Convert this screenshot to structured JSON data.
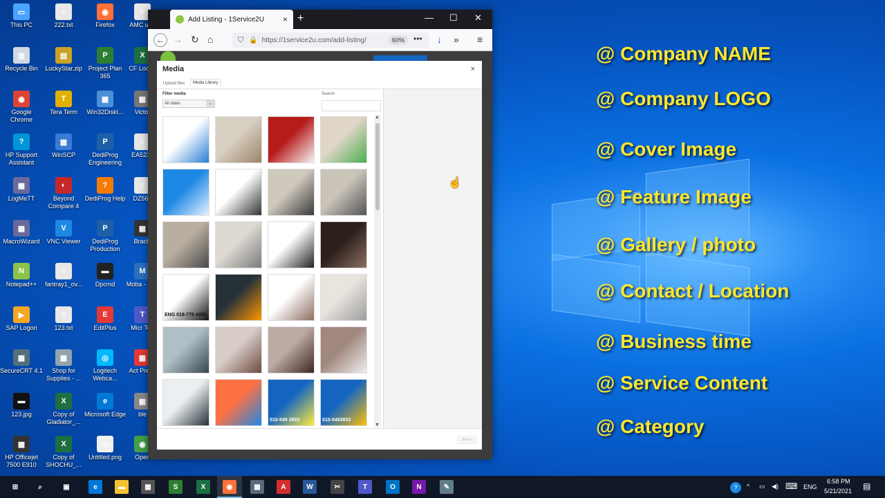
{
  "desktop_icons": [
    {
      "label": "This PC",
      "color": "#4aa3ff",
      "glyph": "▭"
    },
    {
      "label": "222.txt",
      "color": "#e8e8e8",
      "glyph": "≡"
    },
    {
      "label": "Firefox",
      "color": "#ff7139",
      "glyph": "◉"
    },
    {
      "label": "AMC upg",
      "color": "#e8e8e8",
      "glyph": "≡"
    },
    {
      "label": "Recycle Bin",
      "color": "#cfd8e3",
      "glyph": "▥"
    },
    {
      "label": "LuckyStar.zip",
      "color": "#c9a227",
      "glyph": "▤"
    },
    {
      "label": "Project Plan 365",
      "color": "#2e7d32",
      "glyph": "P"
    },
    {
      "label": "CF Loopb",
      "color": "#1d6f42",
      "glyph": "X"
    },
    {
      "label": "Google Chrome",
      "color": "#db4437",
      "glyph": "◉"
    },
    {
      "label": "Tera Term",
      "color": "#e0b000",
      "glyph": "T"
    },
    {
      "label": "Win32DiskI...",
      "color": "#4a90d9",
      "glyph": "▦"
    },
    {
      "label": "Victor",
      "color": "#777",
      "glyph": "▦"
    },
    {
      "label": "HP Support Assistant",
      "color": "#0096d6",
      "glyph": "?"
    },
    {
      "label": "WinSCP",
      "color": "#3a7bd5",
      "glyph": "▦"
    },
    {
      "label": "DediProg Engineering",
      "color": "#1e5fa8",
      "glyph": "P"
    },
    {
      "label": "EA523_",
      "color": "#e8e8e8",
      "glyph": "≡"
    },
    {
      "label": "LogMeTT",
      "color": "#6a6a9a",
      "glyph": "▦"
    },
    {
      "label": "Beyond Compare 4",
      "color": "#c62828",
      "glyph": "◐"
    },
    {
      "label": "DediProg Help",
      "color": "#f57c00",
      "glyph": "?"
    },
    {
      "label": "DZ563",
      "color": "#e8e8e8",
      "glyph": "≡"
    },
    {
      "label": "MacroWizard",
      "color": "#6a6a9a",
      "glyph": "▦"
    },
    {
      "label": "VNC Viewer",
      "color": "#1e88e5",
      "glyph": "V"
    },
    {
      "label": "DediProg Production",
      "color": "#1e5fa8",
      "glyph": "P"
    },
    {
      "label": "Brackl",
      "color": "#333",
      "glyph": "▦"
    },
    {
      "label": "Notepad++",
      "color": "#8bc34a",
      "glyph": "N"
    },
    {
      "label": "fantray1_ov...",
      "color": "#e8e8e8",
      "glyph": "≡"
    },
    {
      "label": "Dpcmd",
      "color": "#222",
      "glyph": "▬"
    },
    {
      "label": "Moba - Sho",
      "color": "#2c6fbf",
      "glyph": "M"
    },
    {
      "label": "SAP Logon",
      "color": "#f5a623",
      "glyph": "▶"
    },
    {
      "label": "123.txt",
      "color": "#e8e8e8",
      "glyph": "≡"
    },
    {
      "label": "EditPlus",
      "color": "#e53935",
      "glyph": "E"
    },
    {
      "label": "Micr Tea",
      "color": "#5059c9",
      "glyph": "T"
    },
    {
      "label": "SecureCRT 4.1",
      "color": "#546e7a",
      "glyph": "▦"
    },
    {
      "label": "Shop for Supplies - ...",
      "color": "#90a4ae",
      "glyph": "▦"
    },
    {
      "label": "Logitech Webca...",
      "color": "#00b8fc",
      "glyph": "◎"
    },
    {
      "label": "Act Prese",
      "color": "#e53935",
      "glyph": "▦"
    },
    {
      "label": "123.jpg",
      "color": "#111",
      "glyph": "▬"
    },
    {
      "label": "Copy of Gladiator_...",
      "color": "#1d6f42",
      "glyph": "X"
    },
    {
      "label": "Microsoft Edge",
      "color": "#0078d7",
      "glyph": "e"
    },
    {
      "label": "ble",
      "color": "#888",
      "glyph": "▦"
    },
    {
      "label": "HP Officejet 7500 E910",
      "color": "#333",
      "glyph": "▦"
    },
    {
      "label": "Copy of SHOCHU_...",
      "color": "#1d6f42",
      "glyph": "X"
    },
    {
      "label": "Untitled.png",
      "color": "#f0f0f0",
      "glyph": "▭"
    },
    {
      "label": "Open",
      "color": "#43a047",
      "glyph": "◉"
    }
  ],
  "features": [
    "@ Company NAME",
    "@ Company LOGO",
    "@  Cover Image",
    "@  Feature Image",
    "@ Gallery / photo",
    "@ Contact / Location",
    "@  Business time",
    "@  Service Content",
    "@  Category"
  ],
  "browser": {
    "tab_title": "Add Listing - 1Service2U",
    "tab_close": "×",
    "new_tab": "+",
    "minimize": "—",
    "maximize": "☐",
    "close": "✕",
    "back": "←",
    "forward": "→",
    "reload": "↻",
    "home": "⌂",
    "url": "https://1service2u.com/add-listing/",
    "zoom": "60%",
    "more": "•••",
    "download": "↓",
    "overflow": "»",
    "menu": "≡"
  },
  "modal": {
    "title": "Media",
    "close": "×",
    "tab_upload": "Upload files",
    "tab_library": "Media Library",
    "filter_label": "Filter media",
    "filter_value": "All dates",
    "search_label": "Search",
    "select_button": "Select",
    "thumbnails": [
      {
        "name": "thumb-plumber-logo",
        "colors": [
          "#ffffff",
          "#2a7fd4"
        ]
      },
      {
        "name": "thumb-pots",
        "colors": [
          "#d8cfc3",
          "#9c8466"
        ]
      },
      {
        "name": "thumb-red-poster",
        "colors": [
          "#b71c1c",
          "#f5f5f5"
        ]
      },
      {
        "name": "thumb-cleaning-collage",
        "colors": [
          "#e0d6c8",
          "#4caf50"
        ]
      },
      {
        "name": "thumb-blue-banner",
        "colors": [
          "#1e88e5",
          "#e3f2fd"
        ]
      },
      {
        "name": "thumb-electric-card",
        "colors": [
          "#ffffff",
          "#333333"
        ]
      },
      {
        "name": "thumb-hallway",
        "colors": [
          "#cfc8bd",
          "#3a3a3a"
        ]
      },
      {
        "name": "thumb-ceiling-room",
        "colors": [
          "#c9c3b8",
          "#555555"
        ]
      },
      {
        "name": "thumb-stairs-light",
        "colors": [
          "#b8aea0",
          "#4a4a4a"
        ]
      },
      {
        "name": "thumb-ceiling-light",
        "colors": [
          "#dedad3",
          "#7a7a7a"
        ]
      },
      {
        "name": "thumb-electric-flyer",
        "colors": [
          "#ffffff",
          "#222222"
        ]
      },
      {
        "name": "thumb-dark-ceiling",
        "colors": [
          "#2a1f1a",
          "#8d6e63"
        ]
      },
      {
        "name": "thumb-electric-card-2",
        "colors": [
          "#ffffff",
          "#111111"
        ]
      },
      {
        "name": "thumb-wires",
        "colors": [
          "#263238",
          "#ff9800"
        ]
      },
      {
        "name": "thumb-tools",
        "colors": [
          "#ffffff",
          "#8d6e63"
        ]
      },
      {
        "name": "thumb-room-fan",
        "colors": [
          "#e8e4de",
          "#9e9e9e"
        ]
      },
      {
        "name": "thumb-ceiling-frame",
        "colors": [
          "#b0bec5",
          "#37474f"
        ]
      },
      {
        "name": "thumb-plaster-ceiling",
        "colors": [
          "#d7ccc8",
          "#6d4c41"
        ]
      },
      {
        "name": "thumb-lit-ceiling",
        "colors": [
          "#bcaaa4",
          "#3e2723"
        ]
      },
      {
        "name": "thumb-room-window",
        "colors": [
          "#a1887f",
          "#eeeeee"
        ]
      },
      {
        "name": "thumb-breaker-box",
        "colors": [
          "#eceff1",
          "#263238"
        ]
      },
      {
        "name": "thumb-blue-light",
        "colors": [
          "#ff7043",
          "#1e88e5"
        ]
      },
      {
        "name": "thumb-tch-cables",
        "colors": [
          "#1565c0",
          "#ffeb3b"
        ]
      },
      {
        "name": "thumb-tch-electrician",
        "colors": [
          "#1565c0",
          "#ffc107"
        ]
      }
    ],
    "thumb_texts": {
      "row4col1": "ENG 018-776 4350",
      "row6col3": "010-549 3933",
      "row6col4": "010-5493933"
    }
  },
  "taskbar": {
    "items": [
      {
        "name": "start-button",
        "glyph": "⊞",
        "color": "#101828"
      },
      {
        "name": "search-button",
        "glyph": "⌕",
        "color": "#101828"
      },
      {
        "name": "task-view-button",
        "glyph": "▣",
        "color": "#101828"
      },
      {
        "name": "edge-taskbar",
        "glyph": "e",
        "color": "#0078d7"
      },
      {
        "name": "explorer-taskbar",
        "glyph": "▬",
        "color": "#f4c430"
      },
      {
        "name": "store-taskbar",
        "glyph": "▦",
        "color": "#555555"
      },
      {
        "name": "app-s-taskbar",
        "glyph": "S",
        "color": "#2e7d32"
      },
      {
        "name": "excel-taskbar",
        "glyph": "X",
        "color": "#1d6f42"
      },
      {
        "name": "firefox-taskbar",
        "glyph": "◉",
        "color": "#ff7139"
      },
      {
        "name": "calculator-taskbar",
        "glyph": "▦",
        "color": "#5a6a7a"
      },
      {
        "name": "acrobat-taskbar",
        "glyph": "A",
        "color": "#d32f2f"
      },
      {
        "name": "word-taskbar",
        "glyph": "W",
        "color": "#2b579a"
      },
      {
        "name": "snip-taskbar",
        "glyph": "✂",
        "color": "#444444"
      },
      {
        "name": "teams-taskbar",
        "glyph": "T",
        "color": "#5059c9"
      },
      {
        "name": "outlook-taskbar",
        "glyph": "O",
        "color": "#0072c6"
      },
      {
        "name": "onenote-taskbar",
        "glyph": "N",
        "color": "#7719aa"
      },
      {
        "name": "paint-taskbar",
        "glyph": "✎",
        "color": "#607d8b"
      }
    ],
    "lang": "ENG",
    "time": "6:58 PM",
    "date": "5/21/2021",
    "tray_help": "?",
    "tray_up": "^",
    "tray_battery": "▭",
    "tray_volume": "◀)",
    "tray_keyboard": "⌨",
    "notification": "▤"
  }
}
